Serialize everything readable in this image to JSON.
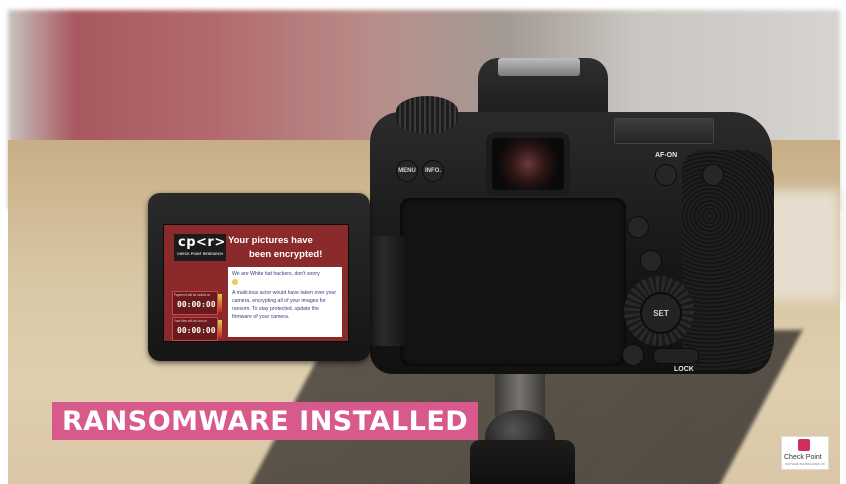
{
  "scene": {
    "description_icon": "camera-photo"
  },
  "camera_lcd": {
    "logo_text": "cp<r>",
    "logo_subtitle": "CHECK POINT RESEARCH",
    "title_line1": "Your pictures have",
    "title_line2": "been encrypted!",
    "timer1_label": "Payment will be raised on",
    "timer1_value": "00:00:00",
    "timer2_label": "Your files will be lost on",
    "timer2_value": "00:00:00",
    "note_line1": "We are White hat hackers, don't worry",
    "note_paragraph": "A malicious actor would have taken over your camera, encrypting all of your images for ransom. To stay protected, update the firmware of your camera."
  },
  "camera_labels": {
    "menu": "MENU",
    "info": "INFO.",
    "af_on": "AF-ON",
    "set": "SET",
    "lock": "LOCK"
  },
  "caption": {
    "text": "RANSOMWARE INSTALLED",
    "color": "#d85a8c"
  },
  "watermark": {
    "brand": "Check Point",
    "tagline": "SOFTWARE TECHNOLOGIES LTD."
  }
}
